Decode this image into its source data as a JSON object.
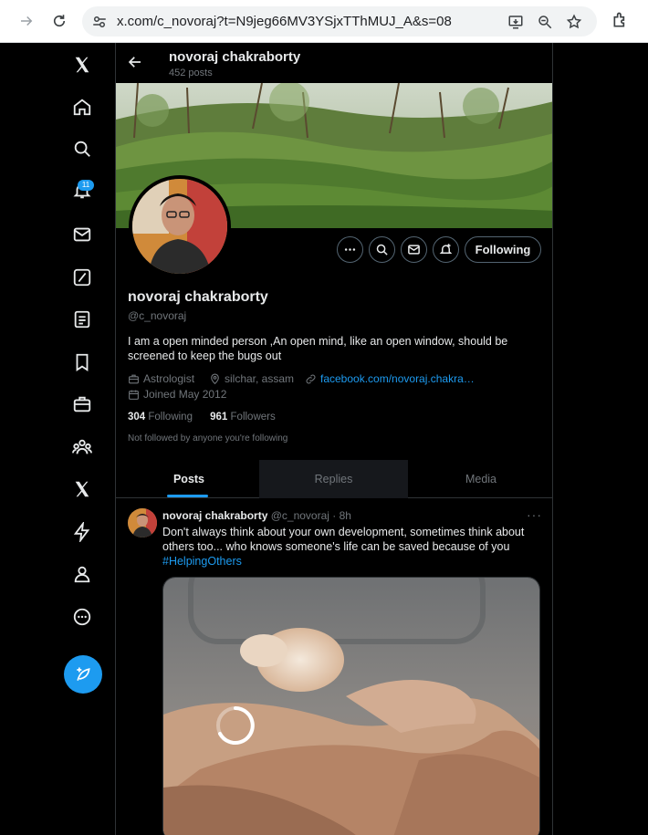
{
  "browser": {
    "url": "x.com/c_novoraj?t=N9jeg66MV3YSjxTThMUJ_A&s=08",
    "icons": [
      "forward-icon",
      "reload-icon",
      "tune-icon",
      "install-app-icon",
      "zoom-icon",
      "bookmark-star-icon",
      "extensions-icon"
    ]
  },
  "nav": {
    "notifications_badge": "11",
    "items": [
      "x-logo",
      "home",
      "explore",
      "notifications",
      "messages",
      "grok",
      "lists",
      "bookmarks",
      "jobs",
      "communities",
      "premium",
      "verified-orgs",
      "profile",
      "more"
    ]
  },
  "header": {
    "name": "novoraj chakraborty",
    "posts_count": "452 posts"
  },
  "profile": {
    "name": "novoraj chakraborty",
    "handle": "@c_novoraj",
    "bio": "I am a open minded person ,An open mind, like an open window, should be screened to keep the bugs out",
    "category": "Astrologist",
    "location": "silchar, assam",
    "website": "facebook.com/novoraj.chakra…",
    "joined": "Joined May 2012",
    "following_count": "304",
    "following_label": "Following",
    "followers_count": "961",
    "followers_label": "Followers",
    "followed_by": "Not followed by anyone you're following",
    "follow_button": "Following"
  },
  "tabs": [
    {
      "label": "Posts",
      "active": true
    },
    {
      "label": "Replies",
      "active": false
    },
    {
      "label": "Media",
      "active": false
    }
  ],
  "post": {
    "author": "novoraj chakraborty",
    "handle": "@c_novoraj",
    "time": "· 8h",
    "text": "Don't always think about your own development, sometimes think about others too... who knows someone's life can be saved because of you",
    "hashtag": "#HelpingOthers",
    "more": "···"
  },
  "colors": {
    "accent": "#1d9bf0",
    "background": "#000000",
    "text_primary": "#e7e9ea",
    "text_secondary": "#71767b",
    "border": "#2f3336"
  }
}
